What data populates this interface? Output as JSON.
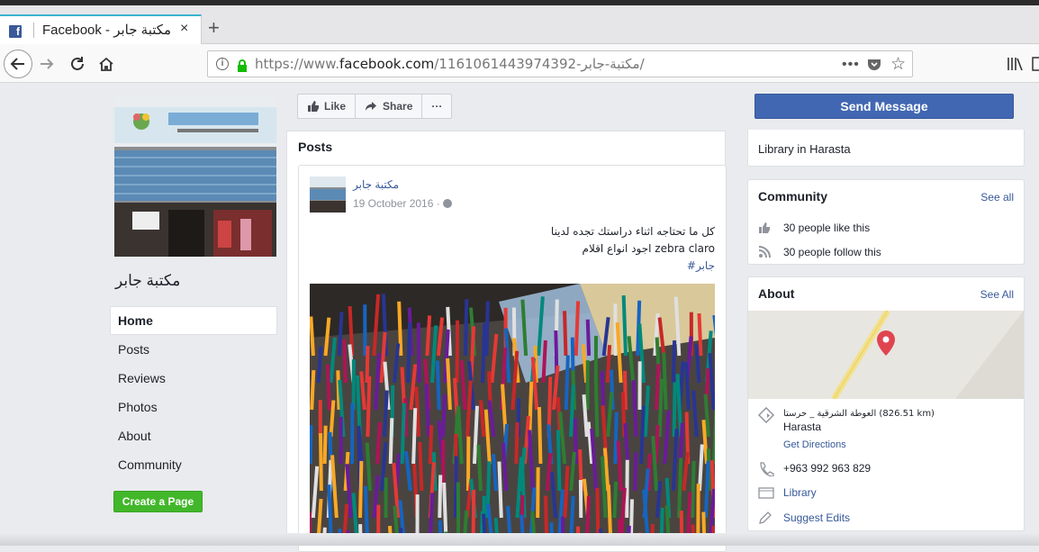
{
  "browser": {
    "tab_title": "Facebook - مكتبة جابر",
    "tab_close": "×",
    "new_tab": "+",
    "url_prefix": "https://www.",
    "url_domain": "facebook.com",
    "url_path": "/مكتبة-جابر-1161061443974392/",
    "page_actions": "•••",
    "icons": [
      "facebook-icon",
      "back-icon",
      "forward-icon",
      "reload-icon",
      "home-icon",
      "info-icon",
      "lock-icon",
      "pocket-icon",
      "bookmark-star-icon",
      "library-icon"
    ]
  },
  "page": {
    "name": "مكتبة جابر",
    "nav": [
      "Home",
      "Posts",
      "Reviews",
      "Photos",
      "About",
      "Community"
    ],
    "create_page": "Create a Page"
  },
  "actions": {
    "like": "Like",
    "share": "Share",
    "more": "···"
  },
  "posts": {
    "header": "Posts",
    "author": "مكتبة جابر",
    "date": "19 October 2016 ·",
    "line1": "كل ما تحتاجه اثناء دراستك تجده لدينا",
    "line2": "اجود انواع اقلام zebra claro",
    "hashtag": "#جابر"
  },
  "sidebar": {
    "send_message": "Send Message",
    "category": "Library in Harasta",
    "community": {
      "title": "Community",
      "see_all": "See all",
      "likes": "30 people like this",
      "follows": "30 people follow this"
    },
    "about": {
      "title": "About",
      "see_all": "See All",
      "address": "العوطة الشرقية _ حرستا (826.51 km)",
      "city": "Harasta",
      "directions": "Get Directions",
      "phone": "+963 992 963 829",
      "category": "Library",
      "suggest": "Suggest Edits"
    }
  },
  "colors": {
    "fb_blue": "#4267b2",
    "link": "#365899",
    "green": "#42b72a",
    "tab_accent": "#3ab4cf",
    "map_pin": "#e0454f"
  }
}
